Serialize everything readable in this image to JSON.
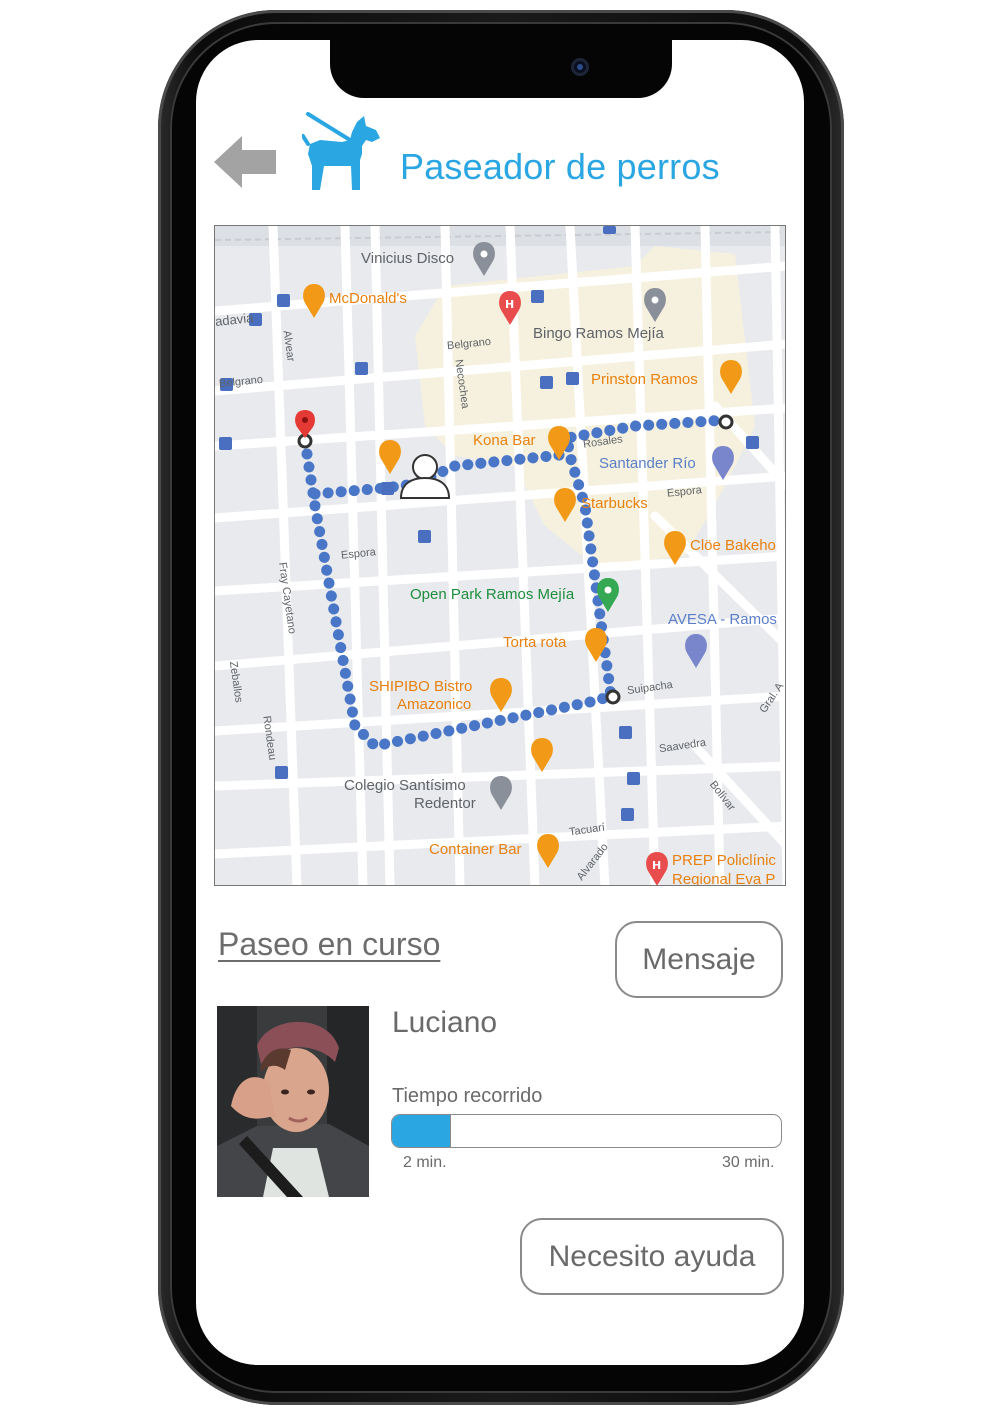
{
  "header": {
    "title": "Paseador de perros"
  },
  "map": {
    "places": {
      "vinicius": "Vinicius Disco",
      "mcdonalds": "McDonald's",
      "bingo": "Bingo Ramos Mejía",
      "prinston": "Prinston Ramos",
      "kona": "Kona Bar",
      "santander": "Santander Río",
      "starbucks": "Starbucks",
      "cloe": "Clöe Bakeho",
      "openpark": "Open Park Ramos Mejía",
      "avesa": "AVESA - Ramos",
      "torta": "Torta rota",
      "shipibo1": "SHIPIBO Bistro",
      "shipibo2": "Amazonico",
      "colegio1": "Colegio Santísimo",
      "colegio2": "Redentor",
      "container": "Container Bar",
      "prep1": "PREP Policlínic",
      "prep2": "Regional Eva P"
    },
    "streets": {
      "adavia": "adavia",
      "alvear": "Alvear",
      "belgrano_w": "Belgrano",
      "belgrano_c": "Belgrano",
      "necochea": "Necochea",
      "rosales": "Rosales",
      "espora_w": "Espora",
      "espora_e": "Espora",
      "fray": "Fray Cayetano",
      "rondeau": "Rondeau",
      "suipacha": "Suipacha",
      "saavedra": "Saavedra",
      "bolivar": "Bolívar",
      "tacuari": "Tacuarí",
      "alvarado": "Alvarado",
      "gral": "Gral. A",
      "zeballos": "Zeballos"
    },
    "route_color": "#4a76c8"
  },
  "walk": {
    "section_title": "Paseo en curso",
    "message_button": "Mensaje",
    "walker_name": "Luciano",
    "time_label": "Tiempo recorrido",
    "elapsed": "2 min.",
    "total": "30 min.",
    "progress": 0.15,
    "help_button": "Necesito ayuda"
  },
  "colors": {
    "accent": "#2aa6e2",
    "text_gray": "#6a6a6a"
  }
}
